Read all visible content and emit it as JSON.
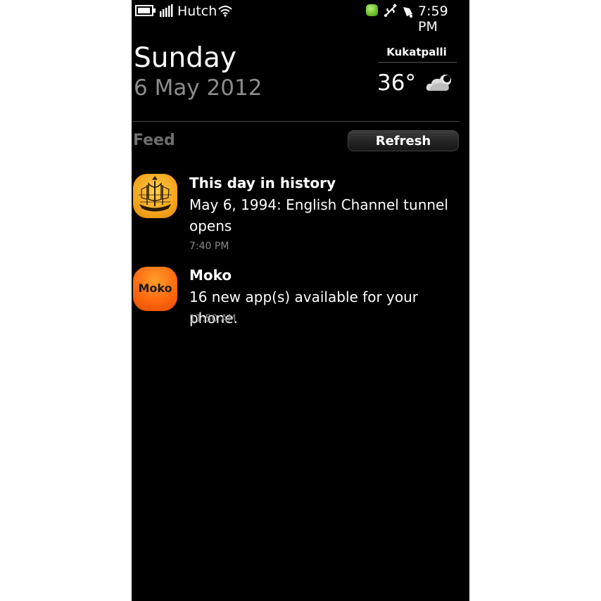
{
  "status_bar": {
    "carrier": "Hutch",
    "time": "7:59 PM",
    "icons": [
      "battery-icon",
      "signal-icon",
      "wifi-icon",
      "notification-dot-icon",
      "usb-icon",
      "alarm-icon"
    ]
  },
  "header": {
    "day": "Sunday",
    "date": "6 May 2012"
  },
  "weather": {
    "location": "Kukatpalli",
    "temperature": "36°",
    "condition_icon": "cloud-icon"
  },
  "feed": {
    "label": "Feed",
    "refresh_label": "Refresh",
    "items": [
      {
        "icon": "ship-icon",
        "title": "This day in history",
        "text": "May 6, 1994: English Channel tunnel opens",
        "time": "7:40 PM"
      },
      {
        "icon_label": "Moko",
        "title": "Moko",
        "text": "16 new app(s) available for your phone.",
        "time": "11:50 AM"
      }
    ]
  },
  "colors": {
    "background": "#000000",
    "date_gray": "#8c8c8c",
    "history_icon_orange": "#f3a21b",
    "moko_icon_orange": "#ff6a10"
  }
}
